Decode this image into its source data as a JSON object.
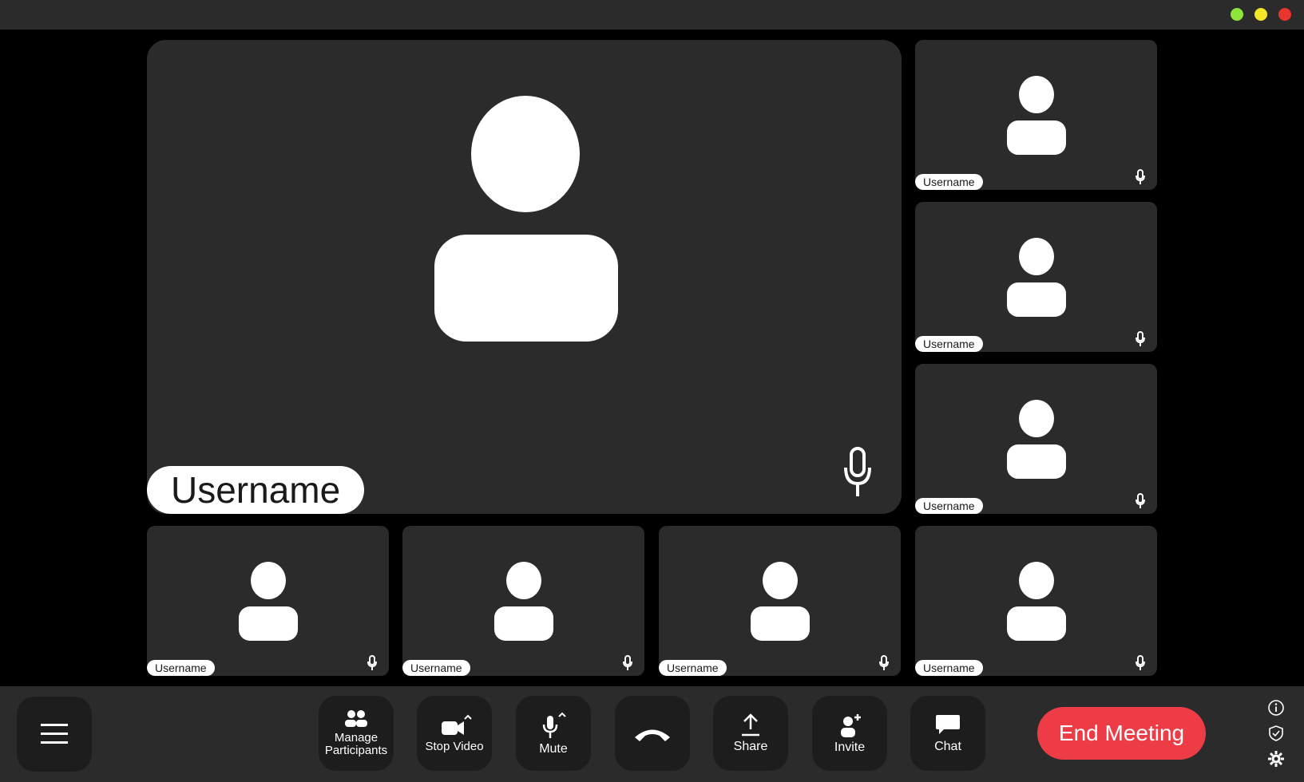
{
  "window": {
    "controls": [
      {
        "name": "green",
        "color": "#8ee63a"
      },
      {
        "name": "yellow",
        "color": "#f2e52a"
      },
      {
        "name": "red",
        "color": "#e9352e"
      }
    ]
  },
  "participants": {
    "main": {
      "name": "Username",
      "mic": "microphone-icon"
    },
    "tiles": [
      {
        "name": "Username"
      },
      {
        "name": "Username"
      },
      {
        "name": "Username"
      },
      {
        "name": "Username"
      },
      {
        "name": "Username"
      },
      {
        "name": "Username"
      },
      {
        "name": "Username"
      }
    ]
  },
  "toolbar": {
    "menu_icon": "hamburger-menu-icon",
    "manage_participants_label": "Manage Participants",
    "stop_video_label": "Stop Video",
    "mute_label": "Mute",
    "hangup_icon": "phone-hangup-icon",
    "share_label": "Share",
    "invite_label": "Invite",
    "chat_label": "Chat",
    "end_meeting_label": "End Meeting",
    "end_meeting_color": "#ee3c47",
    "side_icons": [
      "info-icon",
      "shield-icon",
      "gear-icon"
    ]
  },
  "colors": {
    "tile_bg": "#2b2b2b",
    "stage_bg": "#000000",
    "button_bg": "#1d1d1d"
  }
}
